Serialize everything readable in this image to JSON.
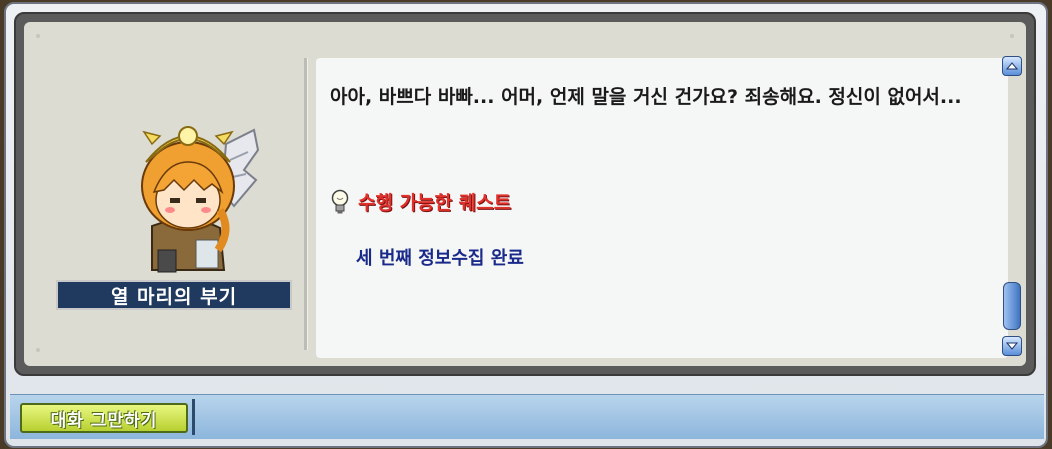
{
  "npc": {
    "name": "열 마리의 부기"
  },
  "dialog": {
    "text": "아아, 바쁘다 바빠... 어머, 언제 말을 거신 건가요? 죄송해요. 정신이 없어서...",
    "quest_header": "수행 가능한 퀘스트",
    "quest_items": [
      "세 번째 정보수집 완료"
    ]
  },
  "footer": {
    "end_chat_label": "대화 그만하기"
  },
  "colors": {
    "name_plate": "#1f3a5e",
    "quest_header": "#e0322c",
    "quest_item": "#1a2a8a",
    "end_button": "#b7d030"
  },
  "icons": [
    "lightbulb-icon",
    "scroll-up-icon",
    "scroll-down-icon"
  ]
}
